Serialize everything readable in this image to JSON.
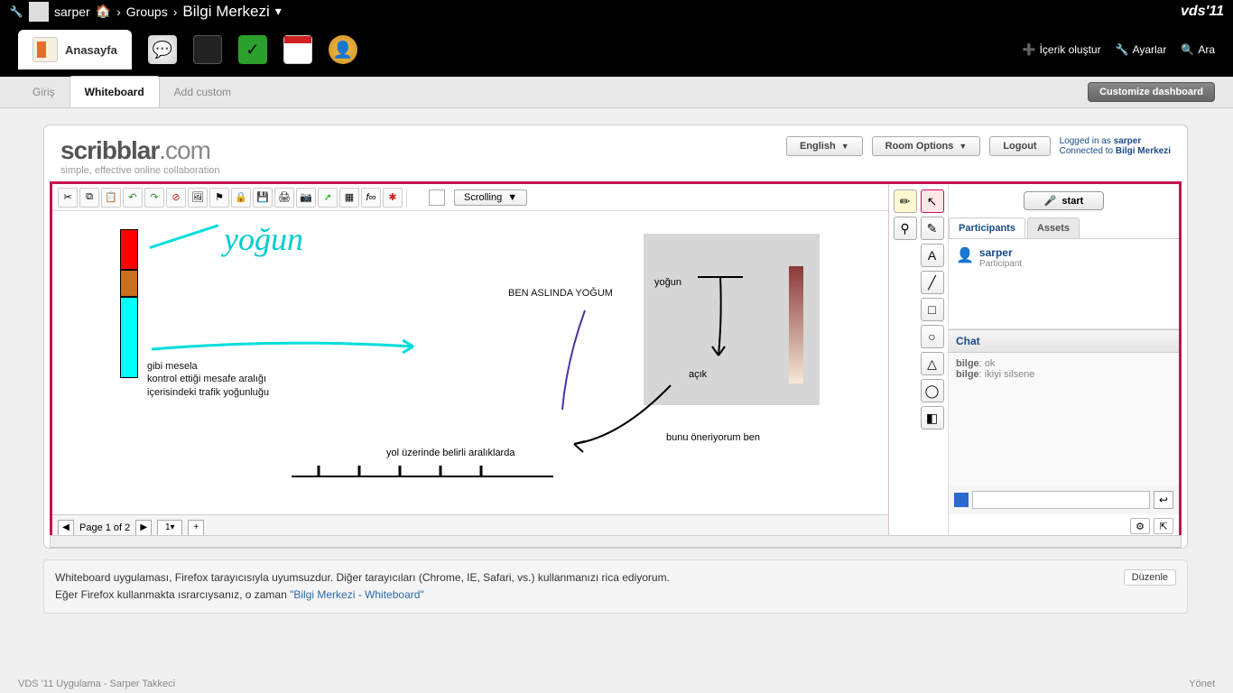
{
  "topbar": {
    "username": "sarper",
    "crumbs": [
      "Groups",
      "Bilgi Merkezi"
    ],
    "site": "vds'11"
  },
  "navbar": {
    "home_label": "Anasayfa",
    "right": {
      "create": "İçerik oluştur",
      "settings": "Ayarlar",
      "search": "Ara"
    }
  },
  "subtabs": {
    "items": [
      "Giriş",
      "Whiteboard",
      "Add custom"
    ],
    "active_index": 1,
    "customize": "Customize dashboard"
  },
  "wb": {
    "brand": "scribblar",
    "brand_suffix": ".com",
    "tagline": "simple, effective online collaboration",
    "buttons": {
      "lang": "English",
      "room": "Room Options",
      "logout": "Logout"
    },
    "logged_prefix": "Logged in as ",
    "logged_user": "sarper",
    "connected_prefix": "Connected to ",
    "connected_room": "Bilgi Merkezi",
    "scroll_mode": "Scrolling",
    "page_label": "Page 1 of 2",
    "page_select": "1",
    "canvas": {
      "cyan_text": "yoğun",
      "text_block": "gibi mesela\nkontrol ettiği mesafe aralığı\niçerisindeki trafik yoğunluğu",
      "center_text": "BEN ASLINDA YOĞUM",
      "road_text": "yol üzerinde belirli aralıklarda",
      "panel_top": "yoğun",
      "panel_bot": "açık",
      "propose": "bunu öneriyorum ben"
    },
    "side": {
      "start": "start",
      "tabs": [
        "Participants",
        "Assets"
      ],
      "active_tab": 0,
      "user": "sarper",
      "role": "Participant",
      "chat_header": "Chat",
      "messages": [
        {
          "from": "bilge",
          "text": "ok"
        },
        {
          "from": "bilge",
          "text": "ikiyi silsene"
        }
      ]
    }
  },
  "notice": {
    "line1": "Whiteboard uygulaması, Firefox tarayıcısıyla uyumsuzdur. Diğer tarayıcıları (Chrome, IE, Safari, vs.) kullanmanızı rica ediyorum.",
    "line2_prefix": "Eğer Firefox kullanmakta ısrarcıysanız, o zaman ",
    "link": "\"Bilgi Merkezi - Whiteboard\"",
    "edit": "Düzenle"
  },
  "footer": {
    "left": "VDS '11 Uygulama - Sarper Takkeci",
    "right": "Yönet"
  }
}
